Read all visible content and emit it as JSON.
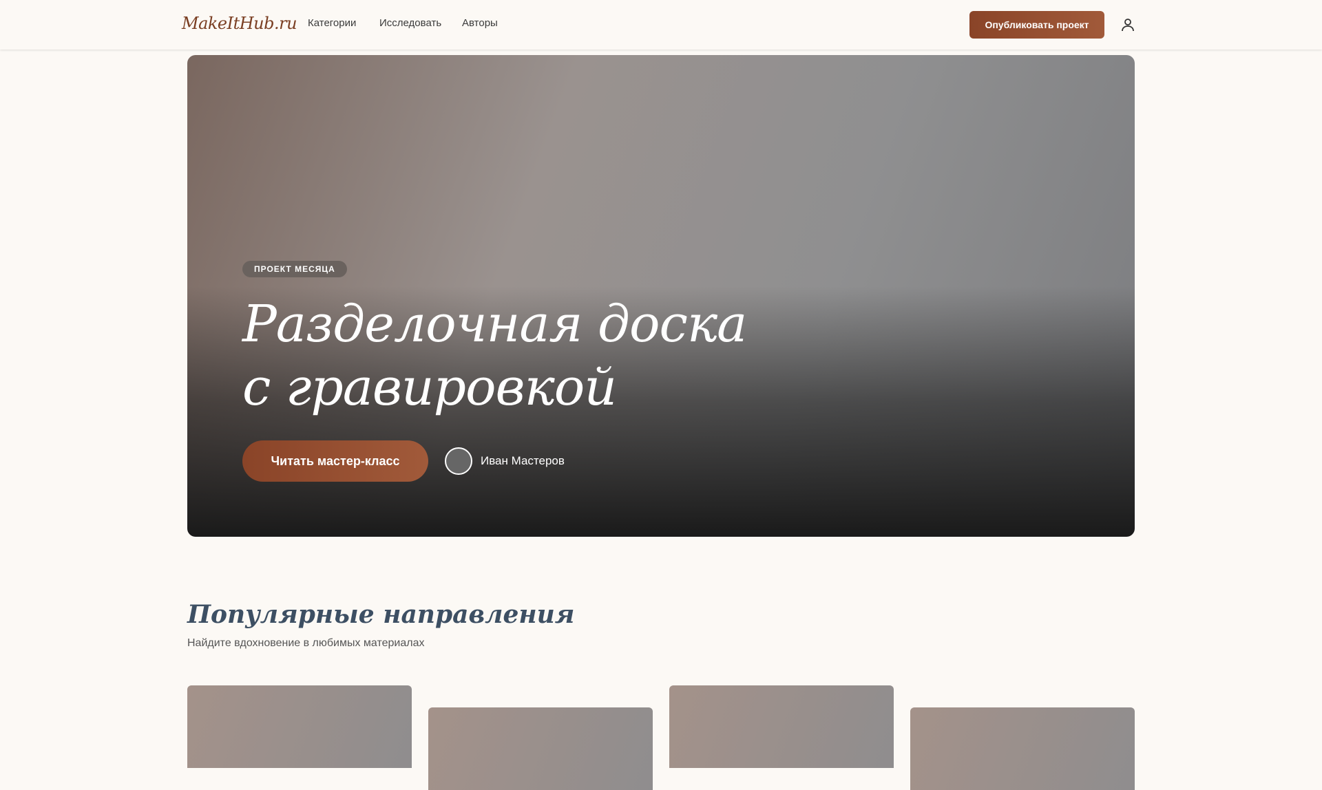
{
  "header": {
    "logo": "MakeItHub.ru",
    "nav": [
      "Категории",
      "Исследовать",
      "Авторы"
    ],
    "publish_label": "Опубликовать проект"
  },
  "hero": {
    "badge": "ПРОЕКТ МЕСЯЦА",
    "title": "Разделочная доска с гравировкой",
    "cta_label": "Читать мастер-класс",
    "author": "Иван Мастеров"
  },
  "section": {
    "title": "Популярные направления",
    "subtitle": "Найдите вдохновение в любимых материалах"
  },
  "colors": {
    "accent": "#8a4428",
    "background": "#fcf9f5",
    "heading": "#3d4f63"
  }
}
